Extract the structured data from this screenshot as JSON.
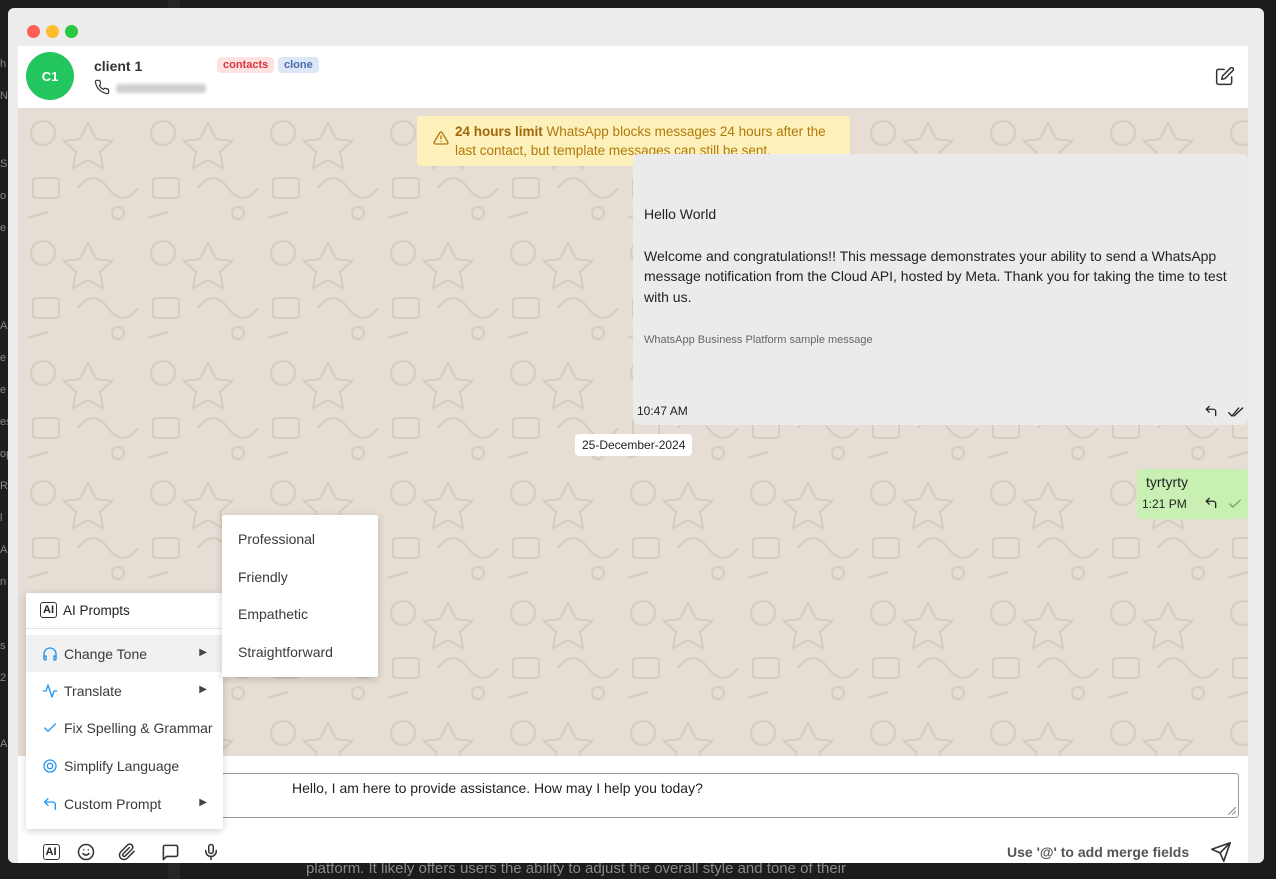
{
  "header": {
    "avatar_initials": "C1",
    "client_name": "client 1",
    "tags": [
      "contacts",
      "clone"
    ]
  },
  "warning": {
    "bold": "24 hours limit",
    "text": " WhatsApp blocks messages 24 hours after the last contact, but template messages can still be sent."
  },
  "messages": {
    "incoming": {
      "title": "Hello World",
      "body": "Welcome and congratulations!! This message demonstrates your ability to send a WhatsApp message notification from the Cloud API, hosted by Meta. Thank you for taking the time to test with us.",
      "footer": "WhatsApp Business Platform sample message",
      "time": "10:47 AM"
    },
    "date_chip": "25-December-2024",
    "outgoing": {
      "text": "tyrtyrty",
      "time": "1:21 PM"
    }
  },
  "composer": {
    "input_text": "Hello, I am here to provide assistance. How may I help you today?",
    "merge_hint": "Use '@' to add merge fields",
    "ai_label": "AI"
  },
  "ai_menu": {
    "title": "AI Prompts",
    "items": [
      {
        "label": "Change Tone",
        "icon": "headphones-icon",
        "submenu": true
      },
      {
        "label": "Translate",
        "icon": "activity-icon",
        "submenu": true
      },
      {
        "label": "Fix Spelling & Grammar",
        "icon": "check-icon",
        "submenu": false
      },
      {
        "label": "Simplify Language",
        "icon": "target-icon",
        "submenu": false
      },
      {
        "label": "Custom Prompt",
        "icon": "reply-arrow-icon",
        "submenu": true
      }
    ]
  },
  "tone_menu": {
    "items": [
      "Professional",
      "Friendly",
      "Empathetic",
      "Straightforward"
    ]
  },
  "background": {
    "caption": "platform. It likely offers users the ability to adjust the overall style and tone of their"
  },
  "colors": {
    "avatar": "#22c55e",
    "warning_bg": "#fdf0bb",
    "outgoing_bubble": "#c8f0b2",
    "chat_bg": "#e6ddd4"
  }
}
